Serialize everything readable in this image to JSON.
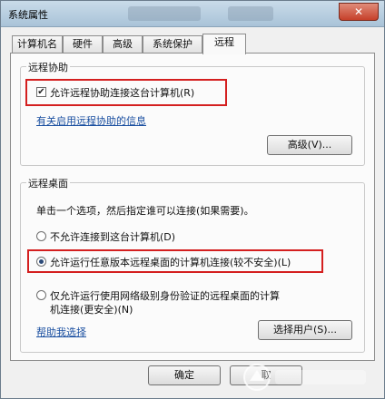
{
  "window": {
    "title": "系统属性",
    "close_glyph": "✕"
  },
  "tabs": [
    {
      "label": "计算机名"
    },
    {
      "label": "硬件"
    },
    {
      "label": "高级"
    },
    {
      "label": "系统保护"
    },
    {
      "label": "远程"
    }
  ],
  "remote_assistance": {
    "group_title": "远程协助",
    "checkbox_label": "允许远程协助连接这台计算机(R)",
    "checked": true,
    "check_glyph": "✔",
    "link_label": "有关启用远程协助的信息",
    "advanced_button": "高级(V)..."
  },
  "remote_desktop": {
    "group_title": "远程桌面",
    "instruction": "单击一个选项，然后指定谁可以连接(如果需要)。",
    "options": [
      {
        "label": "不允许连接到这台计算机(D)",
        "selected": false
      },
      {
        "label": "允许运行任意版本远程桌面的计算机连接(较不安全)(L)",
        "selected": true
      },
      {
        "label_line1": "仅允许运行使用网络级别身份验证的远程桌面的计算",
        "label_line2": "机连接(更安全)(N)",
        "selected": false
      }
    ],
    "help_link": "帮助我选择",
    "select_users_button": "选择用户(S)..."
  },
  "footer": {
    "ok_button": "确定",
    "cancel_button": "取"
  },
  "colors": {
    "highlight": "#d41f1f",
    "link": "#1a4fa0"
  }
}
